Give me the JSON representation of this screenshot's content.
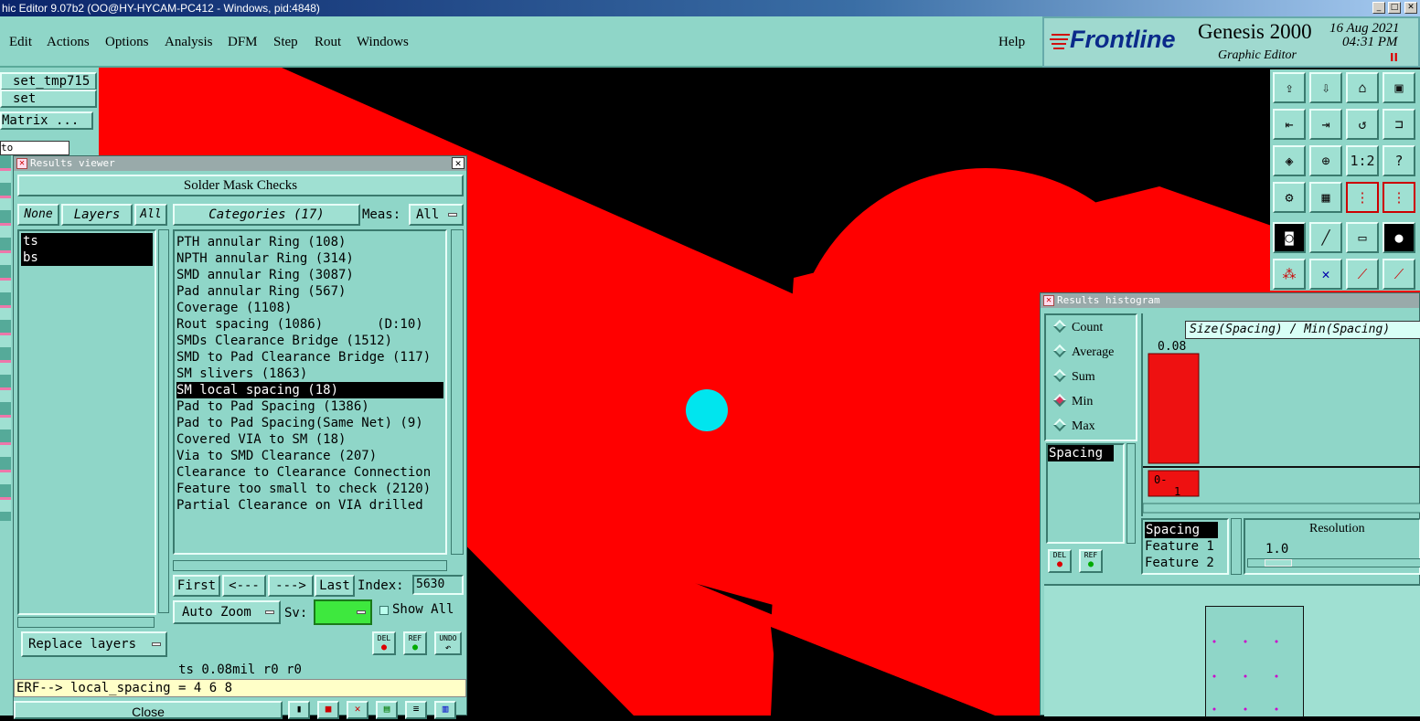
{
  "window": {
    "title": "hic Editor 9.07b2 (OO@HY-HYCAM-PC412 - Windows, pid:4848)",
    "controls": [
      "_",
      "□",
      "✕"
    ]
  },
  "menu": [
    "Edit",
    "Actions",
    "Options",
    "Analysis",
    "DFM",
    "Step",
    "Rout",
    "Windows"
  ],
  "help": "Help",
  "brand": {
    "logo": "Frontline",
    "product": "Genesis 2000",
    "subtitle": "Graphic Editor",
    "date": "16 Aug 2021",
    "time": "04:31 PM",
    "pause": "II"
  },
  "left": {
    "set_tmp": "set_tmp715",
    "set": "set",
    "matrix": "Matrix ...",
    "field": "to"
  },
  "results": {
    "title": "Results viewer",
    "heading": "Solder Mask Checks",
    "none": "None",
    "layers": "Layers",
    "all": "All",
    "categories": "Categories (17)",
    "meas": "Meas:",
    "meas_value": "All",
    "layer_items": [
      "ts",
      "bs"
    ],
    "cats": [
      "PTH annular Ring (108)",
      "NPTH annular Ring (314)",
      "SMD annular Ring (3087)",
      "Pad annular Ring (567)",
      "Coverage (1108)",
      "Rout spacing (1086)       (D:10)",
      "SMDs Clearance Bridge (1512)",
      "SMD to Pad Clearance Bridge (117)",
      "SM slivers (1863)",
      "SM local spacing (18)",
      "Pad to Pad Spacing (1386)",
      "Pad to Pad Spacing(Same Net) (9)",
      "Covered VIA to SM (18)",
      "Via to SMD Clearance (207)",
      "Clearance to Clearance Connection",
      "Feature too small to check (2120)",
      "Partial Clearance on VIA drilled"
    ],
    "selected_index": 9,
    "first": "First",
    "prev": "<---",
    "next": "--->",
    "last": "Last",
    "index_label": "Index:",
    "index_value": "5630",
    "autozoom": "Auto Zoom",
    "sv": "Sv:",
    "showall": "Show All",
    "replace": "Replace layers",
    "del": "DEL",
    "ref": "REF",
    "undo": "UNDO",
    "status": "ts 0.08mil   r0   r0",
    "erf": "ERF--> local_spacing = 4 6 8",
    "close": "Close"
  },
  "histogram": {
    "title": "Results histogram",
    "options": [
      "Count",
      "Average",
      "Sum",
      "Min",
      "Max"
    ],
    "selected": "Min",
    "list_item": "Spacing",
    "chart_title": "Size(Spacing) / Min(Spacing)",
    "bar_label": "0.08",
    "bin_label": "0-",
    "bin_count": "1",
    "fields": [
      "Spacing",
      "Feature 1",
      "Feature 2"
    ],
    "resolution": "Resolution",
    "resolution_value": "1.0",
    "del": "DEL",
    "ref": "REF"
  },
  "chart_data": {
    "type": "bar",
    "title": "Size(Spacing) / Min(Spacing)",
    "categories": [
      "0-"
    ],
    "values": [
      0.08
    ],
    "bar_value_labels": [
      "0.08"
    ],
    "counts": [
      1
    ],
    "xlabel": "",
    "ylabel": "",
    "colors": {
      "bar": "#ee1111"
    }
  },
  "colors": {
    "copper": "#ff0000",
    "bg": "#000000",
    "panel": "#8fd6c8",
    "marker": "#00e5ee"
  }
}
